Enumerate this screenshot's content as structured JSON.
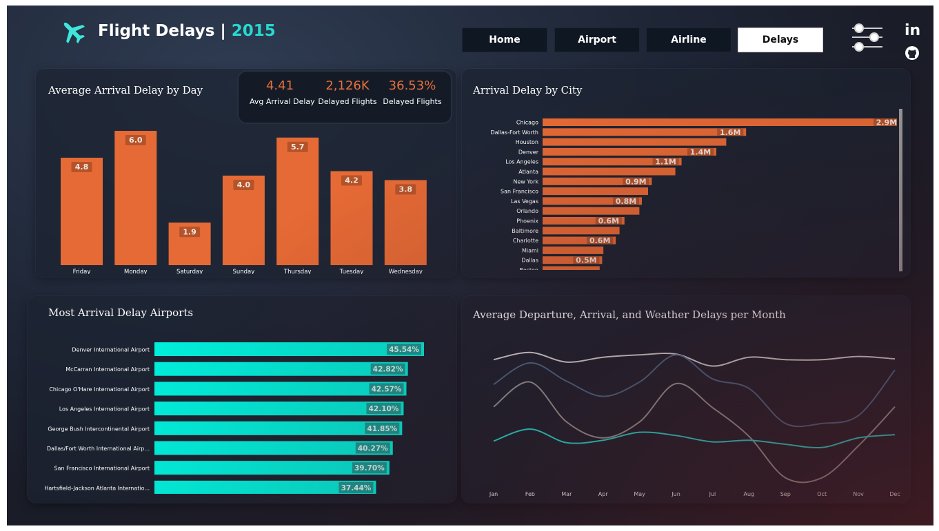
{
  "header": {
    "title": "Flight Delays",
    "separator": "|",
    "year": "2015",
    "nav": [
      "Home",
      "Airport",
      "Airline",
      "Delays"
    ],
    "active_nav": "Delays",
    "icons": [
      "airplane-icon",
      "filter-sliders-icon",
      "linkedin-icon",
      "github-icon"
    ],
    "linkedin_text": "in"
  },
  "colors": {
    "accent_orange": "#e66a35",
    "accent_cyan": "#00f0dc",
    "line_white": "#d9d9d9",
    "line_slate": "#4a6a8c",
    "line_gray": "#9a9a9a",
    "line_cyan": "#20e0d8"
  },
  "kpis": [
    {
      "value": "4.41",
      "label": "Avg Arrival Delay"
    },
    {
      "value": "2,126K",
      "label": "Delayed Flights"
    },
    {
      "value": "36.53%",
      "label": "Delayed Flights"
    }
  ],
  "panels": {
    "day": "Average Arrival Delay by Day",
    "city": "Arrival Delay by City",
    "airports": "Most Arrival Delay Airports",
    "monthly": "Average Departure, Arrival, and Weather Delays per Month"
  },
  "chart_data": [
    {
      "type": "bar",
      "title": "Average Arrival Delay by Day",
      "categories": [
        "Friday",
        "Monday",
        "Saturday",
        "Sunday",
        "Thursday",
        "Tuesday",
        "Wednesday"
      ],
      "values": [
        4.8,
        6.0,
        1.9,
        4.0,
        5.7,
        4.2,
        3.8
      ],
      "labels": [
        "4.8",
        "6.0",
        "1.9",
        "4.0",
        "5.7",
        "4.2",
        "3.8"
      ],
      "ylim": [
        0,
        6.0
      ]
    },
    {
      "type": "bar",
      "orientation": "horizontal",
      "title": "Arrival Delay by City",
      "categories": [
        "Chicago",
        "Dallas-Fort Worth",
        "Houston",
        "Denver",
        "Los Angeles",
        "Atlanta",
        "New York",
        "San Francisco",
        "Las Vegas",
        "Orlando",
        "Phoenix",
        "Baltimore",
        "Charlotte",
        "Miami",
        "Dallas",
        "Boston"
      ],
      "values": [
        2.9,
        1.64,
        1.48,
        1.4,
        1.12,
        1.07,
        0.88,
        0.85,
        0.8,
        0.78,
        0.66,
        0.62,
        0.59,
        0.49,
        0.48,
        0.46
      ],
      "labels": [
        "2.9M",
        "1.6M",
        "",
        "1.4M",
        "1.1M",
        "",
        "0.9M",
        "",
        "0.8M",
        "",
        "0.6M",
        "",
        "0.6M",
        "",
        "0.5M",
        ""
      ],
      "xlim": [
        0,
        2.9
      ]
    },
    {
      "type": "bar",
      "orientation": "horizontal",
      "title": "Most Arrival Delay Airports",
      "categories": [
        "Denver International Airport",
        "McCarran International Airport",
        "Chicago O'Hare International Airport",
        "Los Angeles International Airport",
        "George Bush Intercontinental Airport",
        "Dallas/Fort Worth International Airp...",
        "San Francisco International Airport",
        "Hartsfield-Jackson Atlanta Internatio..."
      ],
      "values": [
        45.54,
        42.82,
        42.57,
        42.1,
        41.85,
        40.27,
        39.7,
        37.44
      ],
      "labels": [
        "45.54%",
        "42.82%",
        "42.57%",
        "42.10%",
        "41.85%",
        "40.27%",
        "39.70%",
        "37.44%"
      ],
      "xlim": [
        0,
        45.54
      ]
    },
    {
      "type": "line",
      "title": "Average Departure, Arrival, and Weather Delays per Month",
      "categories": [
        "Jan",
        "Feb",
        "Mar",
        "Apr",
        "May",
        "Jun",
        "Jul",
        "Aug",
        "Sep",
        "Oct",
        "Nov",
        "Dec"
      ],
      "series": [
        {
          "color": "#d9d9d9",
          "values": [
            8.6,
            9.5,
            8.3,
            8.9,
            9.2,
            9.3,
            7.8,
            8.9,
            8.6,
            8.6,
            9.0,
            8.7
          ]
        },
        {
          "color": "#4a6a8c",
          "values": [
            5.5,
            8.2,
            5.9,
            4.0,
            5.8,
            9.2,
            6.2,
            5.0,
            0.6,
            0.6,
            1.6,
            7.3
          ]
        },
        {
          "color": "#9a9a9a",
          "values": [
            2.7,
            5.8,
            0.8,
            -1.2,
            0.8,
            5.6,
            2.6,
            -1.0,
            -6.2,
            -6.2,
            -2.2,
            2.7
          ]
        },
        {
          "color": "#20e0d8",
          "values": [
            -1.6,
            -0.1,
            -1.8,
            -1.5,
            -0.5,
            -0.9,
            -1.7,
            -1.5,
            -2.0,
            -2.4,
            -1.2,
            -0.8
          ]
        }
      ],
      "ylim": [
        -7,
        10
      ]
    }
  ]
}
